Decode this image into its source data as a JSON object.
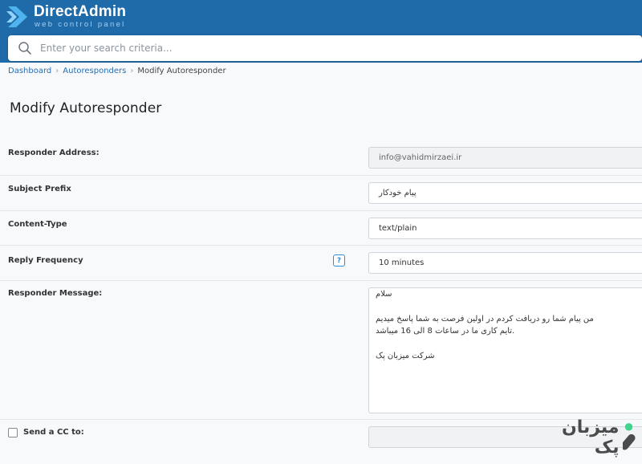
{
  "header": {
    "logo_title": "DirectAdmin",
    "logo_subtitle": "web control panel",
    "bar_color": "#1f6aa8"
  },
  "search": {
    "placeholder": "Enter your search criteria..."
  },
  "breadcrumb": {
    "items": [
      "Dashboard",
      "Autoresponders",
      "Modify Autoresponder"
    ]
  },
  "page_title": "Modify Autoresponder",
  "form": {
    "responder_address": {
      "label": "Responder Address:",
      "value": "info@vahidmirzaei.ir"
    },
    "subject_prefix": {
      "label": "Subject Prefix",
      "value": "پیام خودکار"
    },
    "content_type": {
      "label": "Content-Type",
      "value": "text/plain"
    },
    "reply_frequency": {
      "label": "Reply Frequency",
      "value": "10 minutes",
      "help": "?"
    },
    "responder_message": {
      "label": "Responder Message:",
      "lines": [
        "سلام",
        "من پیام شما رو دریافت کردم در اولین فرصت به شما پاسخ میدیم",
        ".تایم کاری ما در ساعات 8 الی 16 میباشد",
        "شرکت میزبان پک"
      ]
    },
    "send_cc": {
      "label": "Send a CC to:",
      "checked": false,
      "value": ""
    }
  },
  "watermark": {
    "text": "میزبان پک",
    "accent_color": "#3dd68c"
  }
}
